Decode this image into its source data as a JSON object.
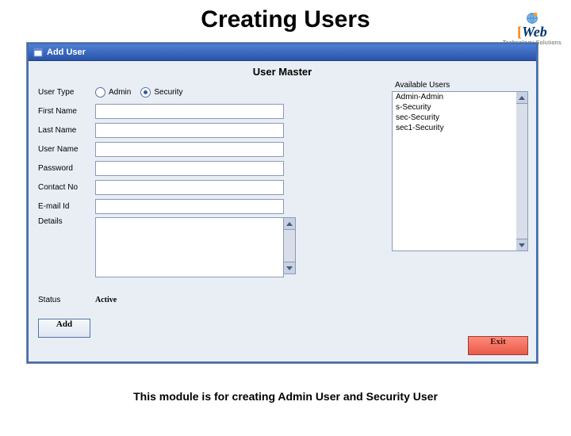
{
  "logo": {
    "tagline_top": "",
    "word": "Web",
    "tagline_bottom": "Technology Solutions"
  },
  "page": {
    "title": "Creating Users",
    "caption": "This module is for creating Admin User and Security User"
  },
  "window": {
    "title": "Add User",
    "heading": "User Master",
    "available_label": "Available Users",
    "status_label": "Status",
    "status_value": "Active",
    "add_button": "Add",
    "exit_button": "Exit"
  },
  "fields": {
    "user_type": {
      "label": "User Type",
      "options": {
        "admin": "Admin",
        "security": "Security"
      },
      "selected": "security"
    },
    "first_name": {
      "label": "First Name",
      "value": ""
    },
    "last_name": {
      "label": "Last Name",
      "value": ""
    },
    "user_name": {
      "label": "User Name",
      "value": ""
    },
    "password": {
      "label": "Password",
      "value": ""
    },
    "contact_no": {
      "label": "Contact No",
      "value": ""
    },
    "email_id": {
      "label": "E-mail Id",
      "value": ""
    },
    "details": {
      "label": "Details",
      "value": ""
    }
  },
  "available_users": [
    "Admin-Admin",
    "s-Security",
    "sec-Security",
    "sec1-Security"
  ]
}
